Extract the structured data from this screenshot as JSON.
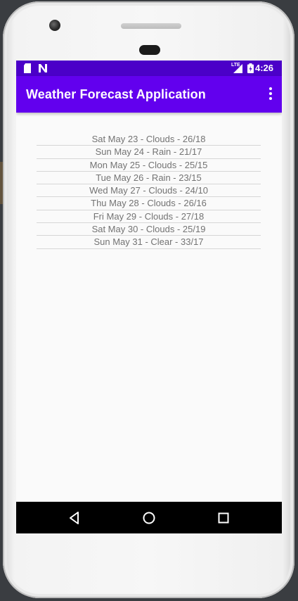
{
  "status_bar": {
    "time": "4:26",
    "network_label": "LTE",
    "icons": [
      "sd-card-icon",
      "n-notification-icon",
      "lte-signal-icon",
      "battery-charging-icon"
    ]
  },
  "app_bar": {
    "title": "Weather Forecast Application",
    "menu_icon": "more-vert-icon"
  },
  "forecast": [
    "Sat May 23 - Clouds - 26/18",
    "Sun May 24 - Rain - 21/17",
    "Mon May 25 - Clouds - 25/15",
    "Tue May 26 - Rain - 23/15",
    "Wed May 27 - Clouds - 24/10",
    "Thu May 28 - Clouds - 26/16",
    "Fri May 29 - Clouds - 27/18",
    "Sat May 30 - Clouds - 25/19",
    "Sun May 31 - Clear - 33/17"
  ],
  "nav_bar": {
    "buttons": [
      "back-icon",
      "home-icon",
      "recents-icon"
    ]
  },
  "colors": {
    "status_bar": "#4b00c8",
    "app_bar": "#6200ee",
    "list_text": "#737373",
    "divider": "#d6d6d6"
  }
}
